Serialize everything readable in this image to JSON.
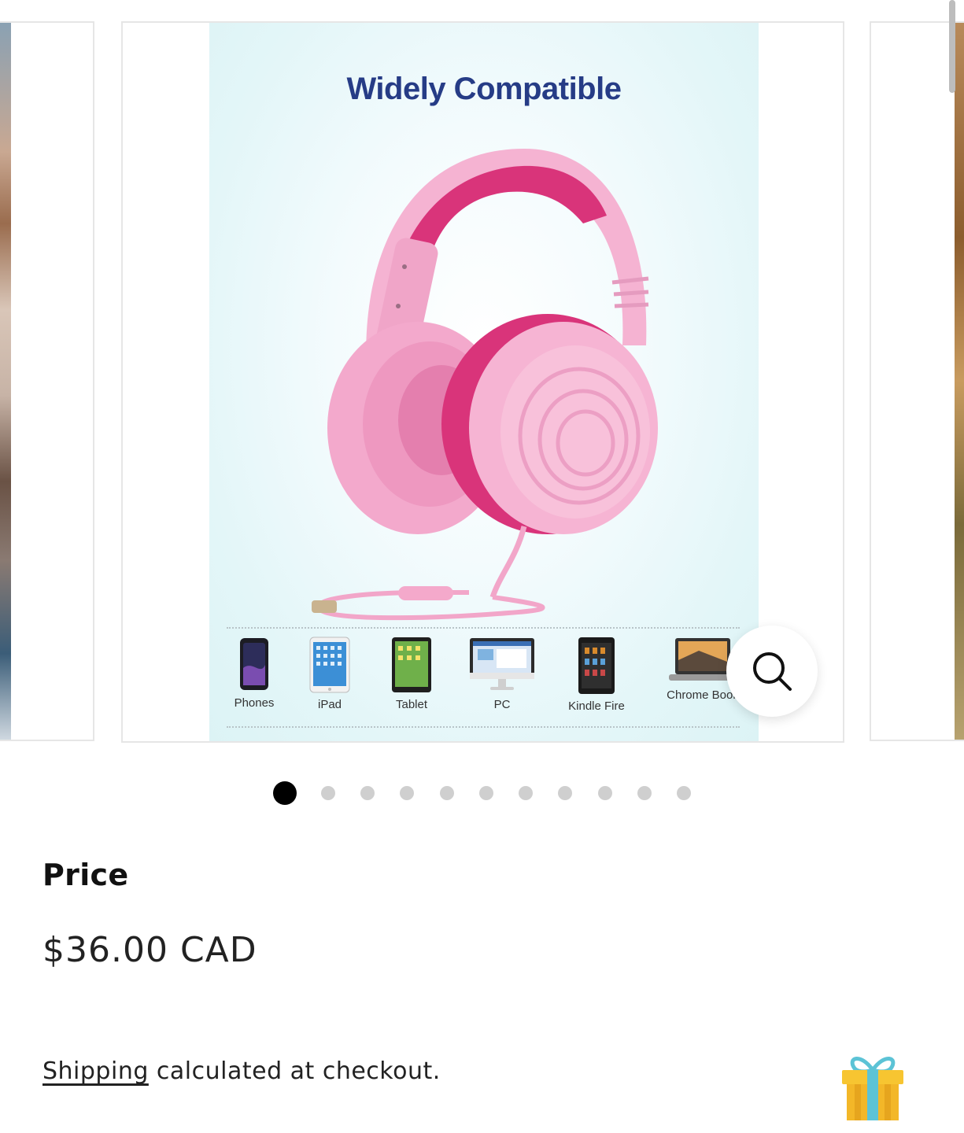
{
  "gallery": {
    "image_headline": "Widely Compatible",
    "devices": [
      {
        "label": "Phones",
        "icon": "phone-icon"
      },
      {
        "label": "iPad",
        "icon": "ipad-icon"
      },
      {
        "label": "Tablet",
        "icon": "tablet-icon"
      },
      {
        "label": "PC",
        "icon": "pc-icon"
      },
      {
        "label": "Kindle Fire",
        "icon": "kindle-icon"
      },
      {
        "label": "Chrome Book",
        "icon": "laptop-icon"
      }
    ],
    "zoom_icon": "search-icon",
    "slide_count": 11,
    "active_slide": 1,
    "colors": {
      "headline": "#263c86",
      "headphone_pink": "#f4a7cc",
      "headphone_accent": "#d9347a",
      "image_background": "#e3f6f8"
    }
  },
  "product": {
    "price_label": "Price",
    "price_value": "$36.00 CAD",
    "shipping_link": "Shipping",
    "shipping_text": " calculated at checkout.",
    "gift_icon": "gift-icon"
  }
}
